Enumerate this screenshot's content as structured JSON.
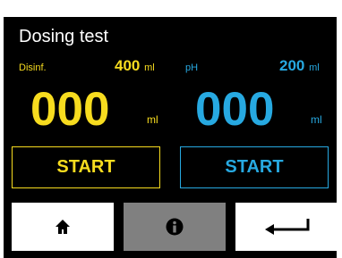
{
  "header": {
    "title": "Dosing test"
  },
  "disinfectant": {
    "label": "Disinf.",
    "volume": "400",
    "volume_unit": "ml",
    "counter": "000",
    "counter_unit": "ml",
    "start_label": "START",
    "color": "#f7dc1f"
  },
  "ph": {
    "label": "pH",
    "volume": "200",
    "volume_unit": "ml",
    "counter": "000",
    "counter_unit": "ml",
    "start_label": "START",
    "color": "#27a9e1"
  },
  "nav": {
    "home_icon": "home-icon",
    "info_icon": "info-icon",
    "back_icon": "back-arrow-icon"
  }
}
